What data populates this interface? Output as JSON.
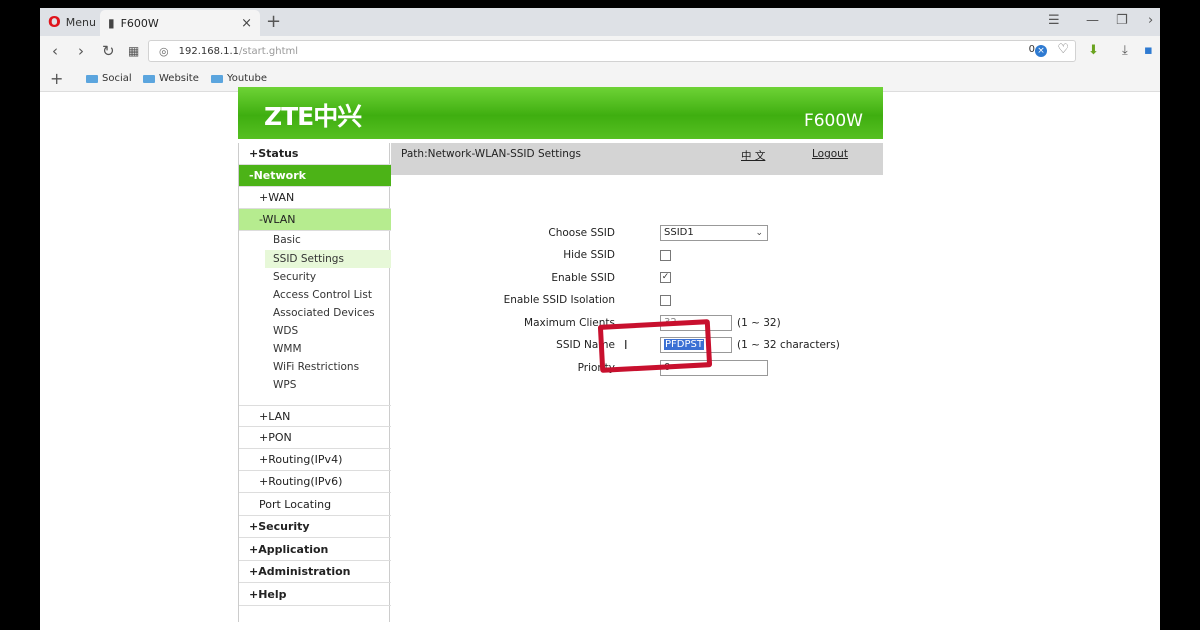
{
  "browser": {
    "menu_label": "Menu",
    "tab_title": "F600W",
    "url_host": "192.168.1.1",
    "url_path": "/start.ghtml",
    "blocked_count": "0",
    "bookmarks": [
      "Social",
      "Website",
      "Youtube"
    ]
  },
  "router": {
    "brand": "ZTE中兴",
    "model": "F600W",
    "path": "Path:Network-WLAN-SSID Settings",
    "lang_link": "中 文",
    "logout": "Logout"
  },
  "sidebar": {
    "status": "+Status",
    "network": "-Network",
    "wan": "+WAN",
    "wlan": "-WLAN",
    "wlan_items": [
      "Basic",
      "SSID Settings",
      "Security",
      "Access Control List",
      "Associated Devices",
      "WDS",
      "WMM",
      "WiFi Restrictions",
      "WPS"
    ],
    "lan": "+LAN",
    "pon": "+PON",
    "routing4": "+Routing(IPv4)",
    "routing6": "+Routing(IPv6)",
    "port_locating": "Port Locating",
    "security": "+Security",
    "application": "+Application",
    "administration": "+Administration",
    "help": "+Help"
  },
  "form": {
    "choose_ssid_label": "Choose SSID",
    "choose_ssid_value": "SSID1",
    "hide_ssid_label": "Hide SSID",
    "hide_ssid_checked": false,
    "enable_ssid_label": "Enable SSID",
    "enable_ssid_checked": true,
    "isolation_label": "Enable SSID Isolation",
    "isolation_checked": false,
    "max_clients_label": "Maximum Clients",
    "max_clients_value": "32",
    "max_clients_hint": "(1 ~ 32)",
    "ssid_name_label": "SSID Name",
    "ssid_name_value": "PFDPST",
    "ssid_name_hint": "(1 ~ 32 characters)",
    "priority_label": "Priority",
    "priority_value": "0"
  }
}
